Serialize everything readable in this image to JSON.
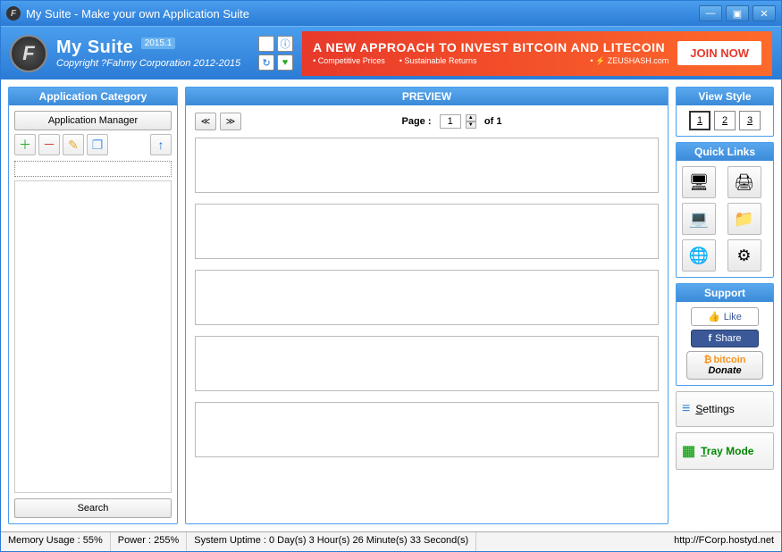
{
  "window": {
    "title": "My Suite - Make your own Application Suite"
  },
  "header": {
    "app_name": "My Suite",
    "version": "2015.1",
    "copyright": "Copyright ?Fahmy Corporation 2012-2015"
  },
  "header_icons": {
    "home": "⌂",
    "info": "ⓘ",
    "refresh": "↻",
    "heart": "♥"
  },
  "ad": {
    "title": "A NEW APPROACH TO INVEST BITCOIN AND LITECOIN",
    "bullet1": "Competitive Prices",
    "bullet2": "Sustainable Returns",
    "brand": "⚡ ZEUSHASH.com",
    "cta": "JOIN NOW"
  },
  "left": {
    "title": "Application Category",
    "app_manager": "Application Manager",
    "tools": {
      "add": "＋",
      "remove": "－",
      "edit": "✎",
      "copy": "❐",
      "up": "↑"
    },
    "search": "Search"
  },
  "center": {
    "title": "PREVIEW",
    "prev": "≪",
    "next": "≫",
    "page_label": "Page :",
    "page_num": "1",
    "of_label": "of",
    "total_pages": "1"
  },
  "right": {
    "view_title": "View Style",
    "view1": "1",
    "view2": "2",
    "view3": "3",
    "ql_title": "Quick Links",
    "ql": {
      "a": "🖥",
      "b": "🖨",
      "c": "💻",
      "d": "📁",
      "e": "🌐",
      "f": "⚙"
    },
    "support_title": "Support",
    "like": "Like",
    "share": "Share",
    "bitcoin_top": "bitcoin",
    "bitcoin_bottom": "Donate",
    "settings": "Settings",
    "tray": "Tray Mode"
  },
  "status": {
    "mem": "Memory Usage : 55%",
    "power": "Power : 255%",
    "uptime": "System Uptime : 0 Day(s) 3 Hour(s) 26 Minute(s) 33 Second(s)",
    "url": "http://FCorp.hostyd.net"
  }
}
